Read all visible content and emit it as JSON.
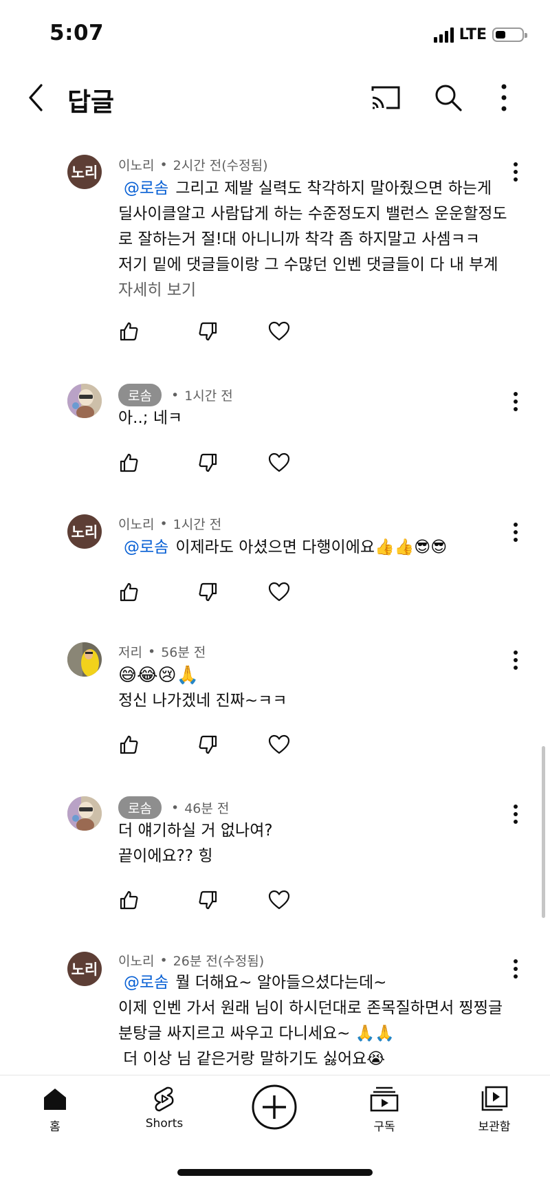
{
  "status_bar": {
    "time": "5:07",
    "network": "LTE"
  },
  "header": {
    "title": "답글"
  },
  "comments": [
    {
      "avatar_text": "노리",
      "author": "이노리",
      "time": "2시간 전(수정됨)",
      "mention": "@로솜",
      "lines": [
        "그리고 제발 실력도 착각하지 말아줬으면 하는게",
        "딜사이클알고 사람답게 하는 수준정도지 밸런스 운운할정도",
        "로 잘하는거 절!대 아니니까 착각 좀 하지말고 사셈ㅋㅋ",
        "저기 밑에 댓글들이랑 그 수많던 인벤 댓글들이 다 내 부계"
      ],
      "read_more": "자세히 보기"
    },
    {
      "author": "로솜",
      "time": "1시간 전",
      "lines": [
        "아..; 네ㅋ"
      ]
    },
    {
      "avatar_text": "노리",
      "author": "이노리",
      "time": "1시간 전",
      "mention": "@로솜",
      "lines": [
        "이제라도 아셨으면 다행이에요👍👍😎😎"
      ]
    },
    {
      "author": "저리",
      "time": "56분 전",
      "lines": [
        "😅😂😢🙏",
        "정신 나가겠네 진짜~ㅋㅋ"
      ]
    },
    {
      "author": "로솜",
      "time": "46분 전",
      "lines": [
        "더 얘기하실 거 없나여?",
        "끝이에요?? 힝"
      ]
    },
    {
      "avatar_text": "노리",
      "author": "이노리",
      "time": "26분 전(수정됨)",
      "mention": "@로솜",
      "lines": [
        "뭘 더해요~ 알아들으셨다는데~",
        "이제 인벤 가서 원래 님이 하시던대로 존목질하면서 찡찡글",
        "분탕글 싸지르고 싸우고 다니세요~ 🙏🙏",
        " 더 이상 님 같은거랑 말하기도 싫어요😭"
      ]
    }
  ],
  "bottom_nav": {
    "home": "홈",
    "shorts": "Shorts",
    "subscriptions": "구독",
    "library": "보관함"
  },
  "colors": {
    "mention": "#065fd4",
    "avatar_brown": "#5d3e35",
    "chip": "#8e8e8e"
  }
}
